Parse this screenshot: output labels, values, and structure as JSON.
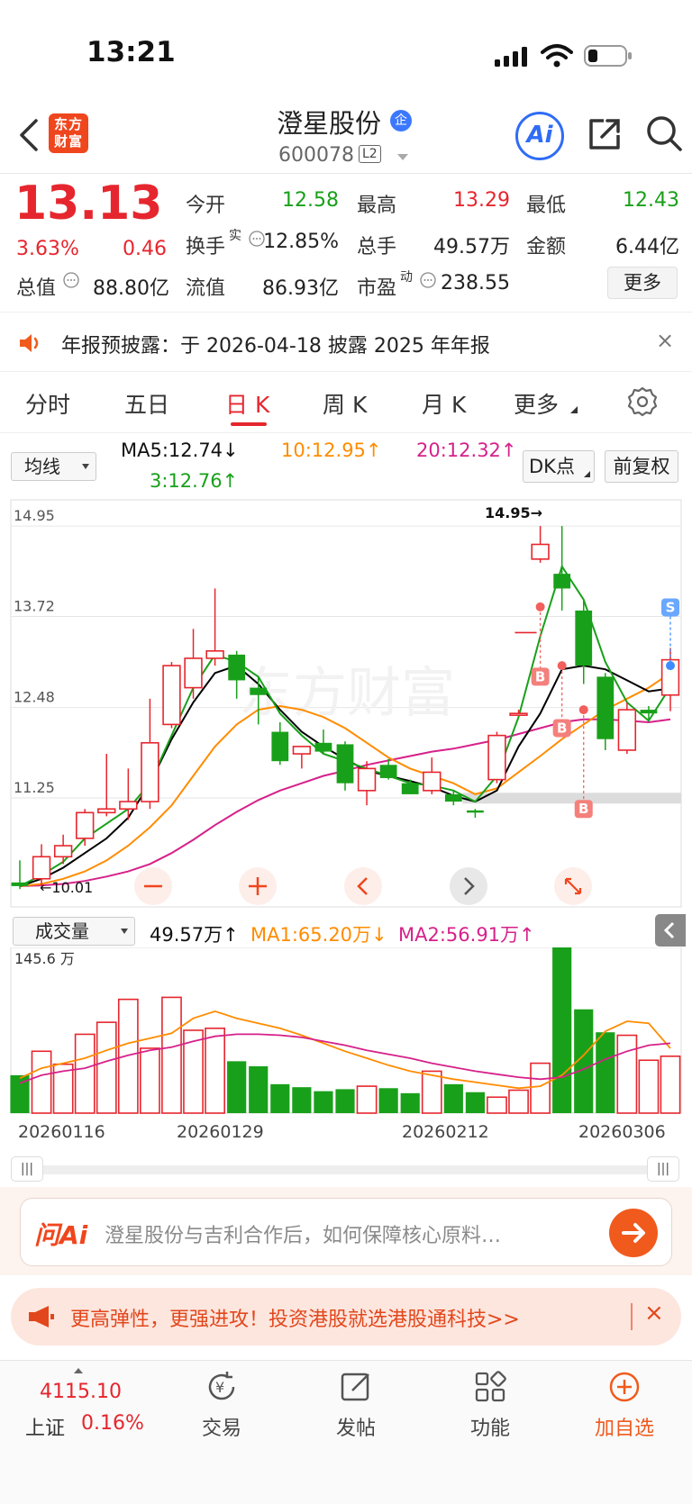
{
  "status_bar": {
    "time": "13:21"
  },
  "header": {
    "brand_logo": "东方财富",
    "stock_name": "澄星股份",
    "firm_badge": "企",
    "stock_code": "600078",
    "level_badge": "L2",
    "ai_label": "Ai"
  },
  "quote": {
    "price": "13.13",
    "pct_change": "3.63%",
    "abs_change": "0.46",
    "fields": {
      "open_label": "今开",
      "open_value": "12.58",
      "high_label": "最高",
      "high_value": "13.29",
      "low_label": "最低",
      "low_value": "12.43",
      "turnover_label": "换手",
      "turnover_sup": "实",
      "turnover_value": "12.85%",
      "volume_label": "总手",
      "volume_value": "49.57万",
      "amount_label": "金额",
      "amount_value": "6.44亿",
      "mktcap_label": "总值",
      "mktcap_value": "88.80亿",
      "float_label": "流值",
      "float_value": "86.93亿",
      "pe_label": "市盈",
      "pe_sup": "动",
      "pe_value": "238.55"
    },
    "more_label": "更多"
  },
  "announcement": {
    "text": "年报预披露：于 2026-04-18 披露 2025 年年报",
    "close": "×"
  },
  "tabs": [
    "分时",
    "五日",
    "日 K",
    "周 K",
    "月 K",
    "更多"
  ],
  "selected_tab": "日 K",
  "ma_row": {
    "select_label": "均线",
    "ma5": "MA5:12.74↓",
    "ma10": "10:12.95↑",
    "ma20": "20:12.32↑",
    "ma3": "3:12.76↑",
    "dk_label": "DK点",
    "fuquan_label": "前复权"
  },
  "colors": {
    "up": "#e6262e",
    "down": "#19a01a",
    "ma5": "#000000",
    "ma10": "#ff8c00",
    "ma20": "#d6218a",
    "ma3": "#19a01a",
    "accent": "#f0461d"
  },
  "chart_data": [
    {
      "type": "candlestick",
      "title": "日K",
      "y_ticks": [
        "14.95",
        "13.72",
        "12.48",
        "11.25"
      ],
      "ylim": [
        10.0,
        15.0
      ],
      "max_label": "14.95→",
      "min_label": "←10.01",
      "markers": [
        "B",
        "B",
        "B",
        "S"
      ],
      "candles": [
        {
          "o": 10.05,
          "h": 10.4,
          "l": 10.01,
          "c": 10.1,
          "d": "down"
        },
        {
          "o": 10.15,
          "h": 10.62,
          "l": 10.05,
          "c": 10.45,
          "d": "up"
        },
        {
          "o": 10.45,
          "h": 10.75,
          "l": 10.35,
          "c": 10.6,
          "d": "up"
        },
        {
          "o": 10.7,
          "h": 11.1,
          "l": 10.6,
          "c": 11.05,
          "d": "up"
        },
        {
          "o": 11.05,
          "h": 11.85,
          "l": 11.0,
          "c": 11.1,
          "d": "up"
        },
        {
          "o": 11.1,
          "h": 11.65,
          "l": 10.95,
          "c": 11.2,
          "d": "up"
        },
        {
          "o": 11.2,
          "h": 12.6,
          "l": 11.1,
          "c": 12.0,
          "d": "up"
        },
        {
          "o": 12.25,
          "h": 13.1,
          "l": 12.2,
          "c": 13.05,
          "d": "up"
        },
        {
          "o": 12.75,
          "h": 13.55,
          "l": 12.6,
          "c": 13.15,
          "d": "up"
        },
        {
          "o": 13.15,
          "h": 14.1,
          "l": 13.05,
          "c": 13.25,
          "d": "up"
        },
        {
          "o": 13.2,
          "h": 13.25,
          "l": 12.6,
          "c": 12.85,
          "d": "down"
        },
        {
          "o": 12.75,
          "h": 12.9,
          "l": 12.25,
          "c": 12.65,
          "d": "down"
        },
        {
          "o": 12.15,
          "h": 12.28,
          "l": 11.7,
          "c": 11.75,
          "d": "down"
        },
        {
          "o": 11.85,
          "h": 11.95,
          "l": 11.65,
          "c": 11.95,
          "d": "up"
        },
        {
          "o": 12.0,
          "h": 12.18,
          "l": 11.85,
          "c": 11.88,
          "d": "down"
        },
        {
          "o": 11.98,
          "h": 12.02,
          "l": 11.35,
          "c": 11.45,
          "d": "down"
        },
        {
          "o": 11.35,
          "h": 11.75,
          "l": 11.15,
          "c": 11.65,
          "d": "up"
        },
        {
          "o": 11.7,
          "h": 11.78,
          "l": 11.5,
          "c": 11.52,
          "d": "down"
        },
        {
          "o": 11.45,
          "h": 11.5,
          "l": 11.3,
          "c": 11.3,
          "d": "down"
        },
        {
          "o": 11.35,
          "h": 11.8,
          "l": 11.3,
          "c": 11.6,
          "d": "up"
        },
        {
          "o": 11.3,
          "h": 11.35,
          "l": 11.15,
          "c": 11.2,
          "d": "down"
        },
        {
          "o": 11.08,
          "h": 11.1,
          "l": 10.98,
          "c": 11.05,
          "d": "down"
        },
        {
          "o": 11.5,
          "h": 12.15,
          "l": 11.45,
          "c": 12.1,
          "d": "up"
        },
        {
          "o": 12.4,
          "h": 12.45,
          "l": 12.4,
          "c": 12.4,
          "d": "up"
        },
        {
          "o": 14.5,
          "h": 14.95,
          "l": 14.45,
          "c": 14.7,
          "d": "up"
        },
        {
          "o": 14.3,
          "h": 14.95,
          "l": 13.8,
          "c": 14.1,
          "d": "down"
        },
        {
          "o": 13.8,
          "h": 13.95,
          "l": 12.8,
          "c": 13.05,
          "d": "down"
        },
        {
          "o": 12.9,
          "h": 12.95,
          "l": 11.9,
          "c": 12.05,
          "d": "down"
        },
        {
          "o": 11.9,
          "h": 12.55,
          "l": 11.85,
          "c": 12.45,
          "d": "up"
        },
        {
          "o": 12.45,
          "h": 12.5,
          "l": 12.3,
          "c": 12.4,
          "d": "down"
        },
        {
          "o": 12.65,
          "h": 13.29,
          "l": 12.43,
          "c": 13.13,
          "d": "up"
        }
      ],
      "ma5": [
        10.05,
        10.15,
        10.3,
        10.5,
        10.7,
        10.98,
        11.45,
        12.05,
        12.55,
        12.95,
        13.05,
        12.8,
        12.45,
        12.15,
        11.95,
        11.78,
        11.62,
        11.55,
        11.48,
        11.4,
        11.28,
        11.2,
        11.35,
        11.95,
        12.4,
        13.0,
        13.05,
        13.0,
        12.85,
        12.7,
        12.74
      ],
      "ma10": [
        10.05,
        10.08,
        10.15,
        10.25,
        10.4,
        10.6,
        10.85,
        11.15,
        11.55,
        11.95,
        12.25,
        12.45,
        12.5,
        12.45,
        12.35,
        12.2,
        12.0,
        11.8,
        11.65,
        11.55,
        11.45,
        11.3,
        11.38,
        11.6,
        11.82,
        12.05,
        12.25,
        12.45,
        12.6,
        12.75,
        12.95
      ],
      "ma20": [
        10.05,
        10.06,
        10.08,
        10.12,
        10.18,
        10.25,
        10.35,
        10.5,
        10.68,
        10.88,
        11.06,
        11.22,
        11.35,
        11.45,
        11.55,
        11.62,
        11.7,
        11.76,
        11.82,
        11.88,
        11.92,
        11.98,
        12.04,
        12.12,
        12.2,
        12.28,
        12.32,
        12.32,
        12.3,
        12.28,
        12.32
      ],
      "ma3": [
        10.05,
        10.2,
        10.38,
        10.7,
        10.9,
        11.1,
        11.45,
        12.1,
        12.75,
        13.2,
        13.1,
        12.9,
        12.4,
        12.1,
        11.85,
        11.75,
        11.65,
        11.55,
        11.45,
        11.42,
        11.35,
        11.2,
        11.55,
        12.35,
        13.45,
        14.4,
        13.95,
        13.1,
        12.55,
        12.3,
        12.76
      ]
    },
    {
      "type": "bar",
      "title": "成交量",
      "y_max_label": "145.6 万",
      "x_ticks": [
        "20260116",
        "20260129",
        "20260212",
        "20260306"
      ],
      "values": [
        38,
        62,
        49,
        79,
        91,
        114,
        65,
        116,
        83,
        85,
        52,
        47,
        29,
        26,
        22,
        24,
        27,
        25,
        20,
        42,
        29,
        21,
        16,
        23,
        50,
        166,
        104,
        81,
        78,
        53,
        57
      ],
      "directions": [
        "down",
        "up",
        "up",
        "up",
        "up",
        "up",
        "up",
        "up",
        "up",
        "up",
        "down",
        "down",
        "down",
        "down",
        "down",
        "down",
        "up",
        "down",
        "down",
        "up",
        "down",
        "down",
        "up",
        "up",
        "up",
        "down",
        "down",
        "down",
        "up",
        "up",
        "up"
      ],
      "ma1": [
        35,
        45,
        50,
        55,
        63,
        70,
        75,
        80,
        95,
        102,
        95,
        90,
        85,
        78,
        70,
        62,
        55,
        48,
        42,
        38,
        34,
        31,
        28,
        25,
        27,
        38,
        58,
        82,
        92,
        90,
        65
      ],
      "ma2": [
        30,
        38,
        42,
        45,
        52,
        58,
        63,
        66,
        72,
        77,
        79,
        79,
        78,
        76,
        72,
        68,
        63,
        59,
        55,
        50,
        46,
        42,
        39,
        36,
        34,
        36,
        44,
        54,
        62,
        68,
        70
      ]
    }
  ],
  "volume_row": {
    "select_label": "成交量",
    "value": "49.57万↑",
    "ma1": "MA1:65.20万↓",
    "ma2": "MA2:56.91万↑"
  },
  "ask_ai": {
    "logo": "问Ai",
    "prompt": "澄星股份与吉利合作后，如何保障核心原料…"
  },
  "promo": {
    "text": "更高弹性，更强进攻！投资港股就选港股通科技>>",
    "close": "×"
  },
  "bottom_bar": {
    "index_value": "4115.10",
    "index_name": "上证",
    "index_change": "0.16%",
    "items": [
      "交易",
      "发帖",
      "功能",
      "加自选"
    ]
  }
}
